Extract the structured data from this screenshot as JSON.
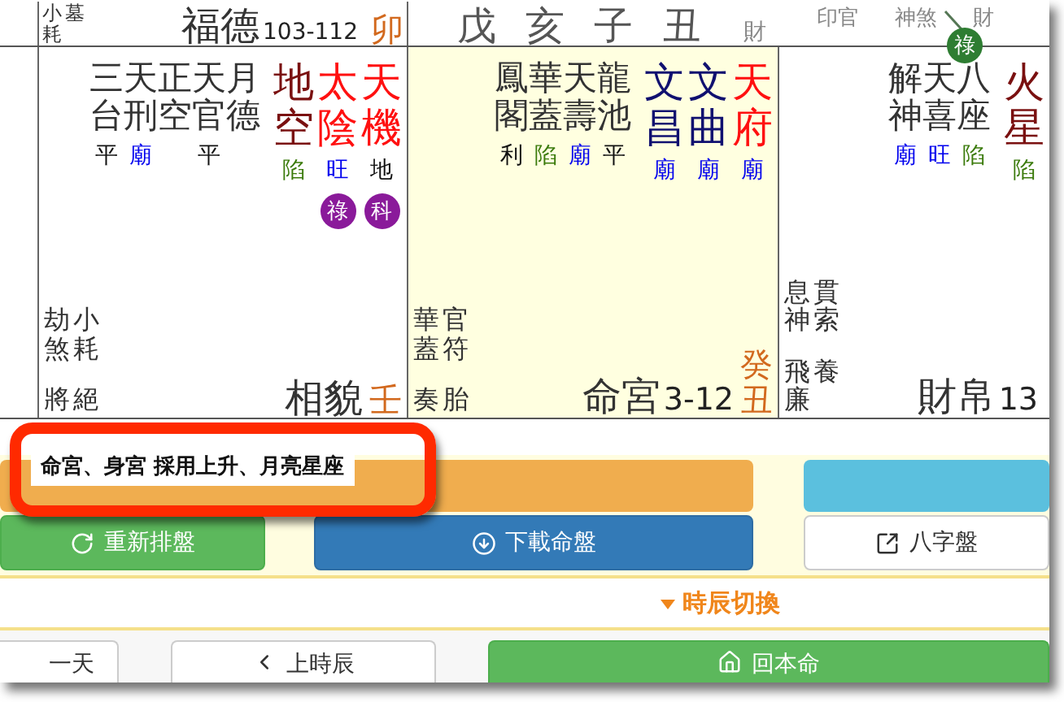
{
  "header": {
    "left": {
      "gods": [
        "小耗",
        "墓"
      ],
      "palace": "福德",
      "ages": "103-112",
      "stem_branch": "卯"
    },
    "pillars": [
      "戊",
      "亥",
      "子",
      "丑"
    ],
    "labels": [
      "財",
      "印官",
      "神煞",
      "財"
    ],
    "transform": {
      "label": "祿",
      "kind": "green"
    }
  },
  "palaces": [
    {
      "highlighted": false,
      "minor_stars": [
        {
          "name": "三台",
          "brightness": {
            "text": "平",
            "color": "#111111"
          }
        },
        {
          "name": "天刑",
          "brightness": {
            "text": "廟",
            "color": "#0000ee"
          }
        },
        {
          "name": "正空"
        },
        {
          "name": "天官",
          "brightness": {
            "text": "平",
            "color": "#111111"
          }
        },
        {
          "name": "月德"
        }
      ],
      "major_stars": [
        {
          "name": "地空",
          "kind": "malefic",
          "brightness": {
            "text": "陷",
            "color": "#3a7a0a"
          }
        },
        {
          "name": "太陰",
          "kind": "main",
          "brightness": {
            "text": "旺",
            "color": "#0000ee"
          },
          "transform": {
            "label": "祿",
            "kind": "purple"
          }
        },
        {
          "name": "天機",
          "kind": "main",
          "brightness": {
            "text": "地",
            "color": "#111111"
          },
          "transform": {
            "label": "科",
            "kind": "purple"
          }
        }
      ],
      "gods": [
        [
          "劫煞",
          "小耗"
        ],
        [
          "將",
          "絕"
        ]
      ],
      "palace": "相貌",
      "stem_branch": "壬"
    },
    {
      "highlighted": true,
      "minor_stars": [
        {
          "name": "鳳閣",
          "brightness": {
            "text": "利",
            "color": "#111111"
          }
        },
        {
          "name": "華蓋",
          "brightness": {
            "text": "陷",
            "color": "#3a7a0a"
          }
        },
        {
          "name": "天壽",
          "brightness": {
            "text": "廟",
            "color": "#0000ee"
          }
        },
        {
          "name": "龍池",
          "brightness": {
            "text": "平",
            "color": "#111111"
          }
        }
      ],
      "major_stars": [
        {
          "name": "文昌",
          "kind": "literary",
          "brightness": {
            "text": "廟",
            "color": "#0000ee"
          }
        },
        {
          "name": "文曲",
          "kind": "literary",
          "brightness": {
            "text": "廟",
            "color": "#0000ee"
          }
        },
        {
          "name": "天府",
          "kind": "main",
          "brightness": {
            "text": "廟",
            "color": "#0000ee"
          }
        }
      ],
      "gods": [
        [
          "華蓋",
          "官符"
        ],
        [
          "奏",
          "胎"
        ]
      ],
      "palace": "命宮",
      "ages": "3-12",
      "stem_branch": "癸丑"
    },
    {
      "highlighted": false,
      "minor_stars": [
        {
          "name": "解神",
          "brightness": {
            "text": "廟",
            "color": "#0000ee"
          }
        },
        {
          "name": "天喜",
          "brightness": {
            "text": "旺",
            "color": "#0000ee"
          }
        },
        {
          "name": "八座",
          "brightness": {
            "text": "陷",
            "color": "#3a7a0a"
          }
        }
      ],
      "major_stars": [
        {
          "name": "火星",
          "kind": "malefic",
          "brightness": {
            "text": "陷",
            "color": "#3a7a0a"
          }
        }
      ],
      "gods": [
        [
          "息神",
          "貫索"
        ],
        [
          "飛廉",
          "養"
        ]
      ],
      "palace": "財帛",
      "ages": "13"
    }
  ],
  "note": "命宮、身宮 採用上升、月亮星座",
  "actions": [
    {
      "label": "重新排盤",
      "kind": "success"
    },
    {
      "label": "下載命盤",
      "kind": "primary"
    },
    {
      "label": "八字盤",
      "kind": "default"
    }
  ],
  "toggle": {
    "label": "時辰切換",
    "expanded": true
  },
  "nav": [
    {
      "label": "一天",
      "kind": "default"
    },
    {
      "label": "上時辰",
      "kind": "default"
    },
    {
      "label": "回本命",
      "kind": "success"
    }
  ]
}
